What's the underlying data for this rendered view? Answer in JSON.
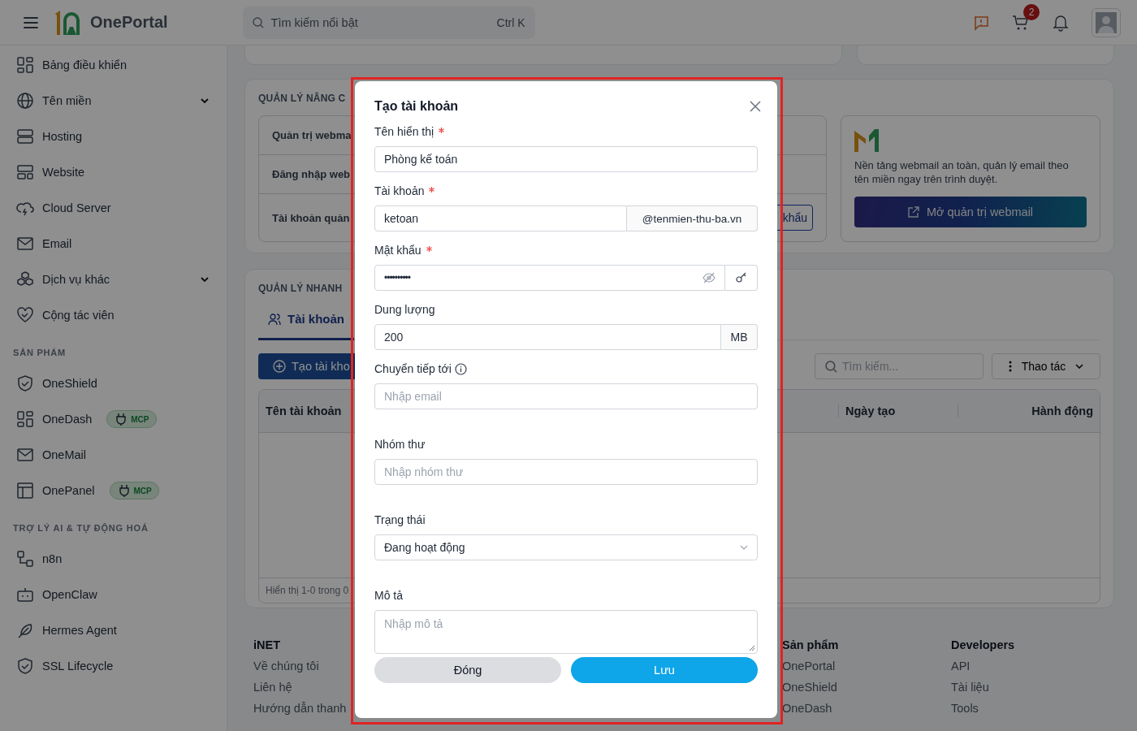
{
  "header": {
    "brand": "OnePortal",
    "search": {
      "placeholder": "Tìm kiếm nổi bật",
      "shortcut": "Ctrl K"
    },
    "cart_count": "2"
  },
  "sidebar": {
    "sections": [
      {
        "items": [
          {
            "label": "Bảng điều khiển",
            "kind": "link"
          },
          {
            "label": "Tên miền",
            "kind": "group",
            "expanded": false
          },
          {
            "label": "Hosting",
            "kind": "link"
          },
          {
            "label": "Website",
            "kind": "link"
          },
          {
            "label": "Cloud Server",
            "kind": "link"
          },
          {
            "label": "Email",
            "kind": "link"
          },
          {
            "label": "Dịch vụ khác",
            "kind": "group",
            "expanded": false
          },
          {
            "label": "Cộng tác viên",
            "kind": "link"
          }
        ]
      },
      {
        "heading": "SẢN PHẨM",
        "items": [
          {
            "label": "OneShield",
            "kind": "link"
          },
          {
            "label": "OneDash",
            "kind": "link",
            "badge": "MCP"
          },
          {
            "label": "OneMail",
            "kind": "link"
          },
          {
            "label": "OnePanel",
            "kind": "link",
            "badge": "MCP"
          }
        ]
      },
      {
        "heading": "TRỢ LÝ AI & TỰ ĐỘNG HOÁ",
        "items": [
          {
            "label": "n8n",
            "kind": "link"
          },
          {
            "label": "OpenClaw",
            "kind": "link"
          },
          {
            "label": "Hermes Agent",
            "kind": "link"
          },
          {
            "label": "SSL Lifecycle",
            "kind": "link"
          }
        ]
      }
    ]
  },
  "advanced": {
    "title": "QUẢN LÝ NÂNG C",
    "rows": [
      "Quản trị webma",
      "Đăng nhập web",
      "Tài khoản quản"
    ],
    "row_button": "khẩu",
    "promo": {
      "text": "Nền tảng webmail an toàn, quản lý email theo tên miền ngay trên trình duyệt.",
      "button": "Mở quản trị webmail"
    }
  },
  "quick": {
    "title": "QUẢN LÝ NHANH",
    "tabs": [
      {
        "label": "Tài khoản",
        "selected": true
      }
    ],
    "create_button": "Tạo tài kho",
    "search": {
      "placeholder": "Tìm kiếm..."
    },
    "actions_button": "Thao tác",
    "table": {
      "columns": [
        "Tên tài khoản",
        "Ngày tạo",
        "Hành động"
      ],
      "summary": "Hiển thị 1-0 trong 0"
    }
  },
  "footer": {
    "columns": [
      {
        "title": "iNET",
        "links": [
          "Về chúng tôi",
          "Liên hệ",
          "Hướng dẫn thanh"
        ]
      },
      {
        "title": "Sản phẩm",
        "links": [
          "OnePortal",
          "OneShield",
          "OneDash"
        ]
      },
      {
        "title": "Developers",
        "links": [
          "API",
          "Tài liệu",
          "Tools"
        ]
      }
    ]
  },
  "modal": {
    "title": "Tạo tài khoản",
    "fields": [
      {
        "kind": "text",
        "label": "Tên hiển thị",
        "required": true,
        "value": "Phòng kế toán"
      },
      {
        "kind": "suffix",
        "label": "Tài khoản",
        "required": true,
        "value": "ketoan",
        "suffix": "@tenmien-thu-ba.vn"
      },
      {
        "kind": "password",
        "label": "Mật khẩu",
        "required": true,
        "value": "••••••••••"
      },
      {
        "kind": "unit",
        "label": "Dung lượng",
        "required": false,
        "value": "200",
        "suffix": "MB"
      },
      {
        "kind": "text",
        "label": "Chuyển tiếp tới",
        "required": false,
        "info": true,
        "placeholder": "Nhập email"
      },
      {
        "kind": "text",
        "label": "Nhóm thư",
        "required": false,
        "placeholder": "Nhập nhóm thư"
      },
      {
        "kind": "select",
        "label": "Trạng thái",
        "required": false,
        "value": "Đang hoạt động"
      },
      {
        "kind": "textarea",
        "label": "Mô tả",
        "required": false,
        "placeholder": "Nhập mô tả"
      }
    ],
    "buttons": [
      {
        "label": "Đóng",
        "kind": "secondary"
      },
      {
        "label": "Lưu",
        "kind": "primary"
      }
    ]
  }
}
